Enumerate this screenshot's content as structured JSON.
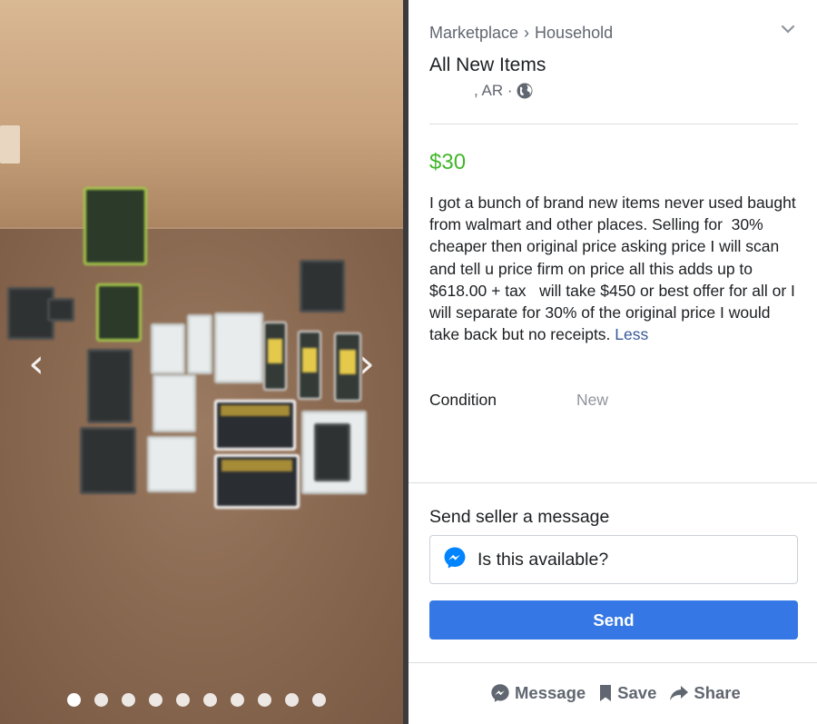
{
  "photo": {
    "prev_arrow": "‹",
    "next_arrow": "›",
    "dot_count": 10,
    "active_dot": 0
  },
  "breadcrumb": {
    "root": "Marketplace",
    "separator": "›",
    "category": "Household"
  },
  "listing": {
    "title": "All New Items",
    "location": ", AR ·",
    "price": "$30",
    "description": "I got a bunch of brand new items never used baught from walmart and other places. Selling for  30% cheaper then original price asking price I will scan and tell u price firm on price all this adds up to $618.00 + tax   will take $450 or best offer for all or I will separate for 30% of the original price I would take back but no receipts. ",
    "less_link": "Less",
    "condition_label": "Condition",
    "condition_value": "New"
  },
  "message": {
    "heading": "Send seller a message",
    "input_value": "Is this available?",
    "send_label": "Send"
  },
  "actions": {
    "message_label": "Message",
    "save_label": "Save",
    "share_label": "Share"
  },
  "colors": {
    "price": "#42b72a",
    "send_button": "#3578e5",
    "link": "#385898",
    "messenger": "#0084ff"
  },
  "icons": [
    "chevron-down-icon",
    "globe-icon",
    "messenger-icon",
    "bookmark-icon",
    "share-arrow-icon",
    "chevron-left-icon",
    "chevron-right-icon"
  ]
}
